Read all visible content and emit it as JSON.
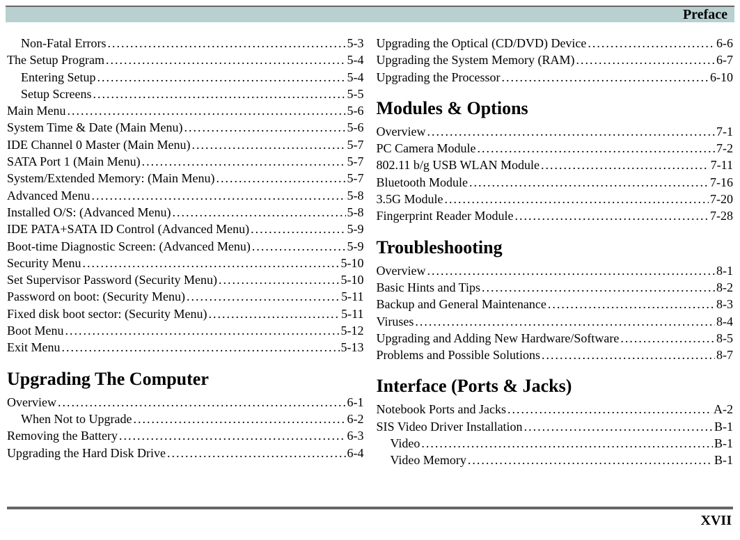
{
  "header": {
    "title": "Preface"
  },
  "footer": {
    "page_number": "XVII"
  },
  "left_column": [
    {
      "type": "entry",
      "indent": 1,
      "label": "Non-Fatal Errors",
      "page": "5-3"
    },
    {
      "type": "entry",
      "indent": 0,
      "label": "The Setup Program",
      "page": "5-4"
    },
    {
      "type": "entry",
      "indent": 1,
      "label": "Entering Setup",
      "page": "5-4"
    },
    {
      "type": "entry",
      "indent": 1,
      "label": "Setup Screens",
      "page": "5-5"
    },
    {
      "type": "entry",
      "indent": 0,
      "label": "Main Menu",
      "page": "5-6"
    },
    {
      "type": "entry",
      "indent": 0,
      "label": "System Time & Date (Main Menu)",
      "page": "5-6"
    },
    {
      "type": "entry",
      "indent": 0,
      "label": "IDE Channel 0 Master (Main Menu)",
      "page": "5-7"
    },
    {
      "type": "entry",
      "indent": 0,
      "label": "SATA Port 1 (Main Menu)",
      "page": "5-7"
    },
    {
      "type": "entry",
      "indent": 0,
      "label": "System/Extended Memory: (Main Menu)",
      "page": "5-7"
    },
    {
      "type": "entry",
      "indent": 0,
      "label": "Advanced Menu",
      "page": "5-8"
    },
    {
      "type": "entry",
      "indent": 0,
      "label": "Installed O/S: (Advanced Menu)",
      "page": "5-8"
    },
    {
      "type": "entry",
      "indent": 0,
      "label": "IDE PATA+SATA ID Control (Advanced Menu)",
      "page": "5-9"
    },
    {
      "type": "entry",
      "indent": 0,
      "label": "Boot-time Diagnostic Screen: (Advanced Menu)",
      "page": "5-9"
    },
    {
      "type": "entry",
      "indent": 0,
      "label": "Security Menu",
      "page": "5-10"
    },
    {
      "type": "entry",
      "indent": 0,
      "label": "Set Supervisor Password (Security Menu)",
      "page": "5-10"
    },
    {
      "type": "entry",
      "indent": 0,
      "label": "Password on boot: (Security Menu)",
      "page": "5-11"
    },
    {
      "type": "entry",
      "indent": 0,
      "label": "Fixed disk boot sector: (Security Menu)",
      "page": "5-11"
    },
    {
      "type": "entry",
      "indent": 0,
      "label": "Boot Menu",
      "page": "5-12"
    },
    {
      "type": "entry",
      "indent": 0,
      "label": "Exit Menu",
      "page": "5-13"
    },
    {
      "type": "heading",
      "label": "Upgrading The Computer"
    },
    {
      "type": "entry",
      "indent": 0,
      "label": "Overview",
      "page": "6-1"
    },
    {
      "type": "entry",
      "indent": 1,
      "label": "When Not to Upgrade",
      "page": "6-2"
    },
    {
      "type": "entry",
      "indent": 0,
      "label": "Removing the Battery",
      "page": "6-3"
    },
    {
      "type": "entry",
      "indent": 0,
      "label": "Upgrading the Hard Disk Drive",
      "page": "6-4"
    }
  ],
  "right_column": [
    {
      "type": "entry",
      "indent": 0,
      "label": "Upgrading the Optical (CD/DVD) Device",
      "page": "6-6"
    },
    {
      "type": "entry",
      "indent": 0,
      "label": "Upgrading the System Memory (RAM)",
      "page": "6-7"
    },
    {
      "type": "entry",
      "indent": 0,
      "label": "Upgrading the Processor",
      "page": "6-10"
    },
    {
      "type": "heading",
      "label": "Modules & Options"
    },
    {
      "type": "entry",
      "indent": 0,
      "label": "Overview",
      "page": "7-1"
    },
    {
      "type": "entry",
      "indent": 0,
      "label": "PC Camera Module",
      "page": "7-2"
    },
    {
      "type": "entry",
      "indent": 0,
      "label": "802.11 b/g USB WLAN Module",
      "page": "7-11"
    },
    {
      "type": "entry",
      "indent": 0,
      "label": "Bluetooth Module",
      "page": "7-16"
    },
    {
      "type": "entry",
      "indent": 0,
      "label": "3.5G Module",
      "page": "7-20"
    },
    {
      "type": "entry",
      "indent": 0,
      "label": "Fingerprint Reader Module",
      "page": "7-28"
    },
    {
      "type": "heading",
      "label": "Troubleshooting"
    },
    {
      "type": "entry",
      "indent": 0,
      "label": "Overview",
      "page": "8-1"
    },
    {
      "type": "entry",
      "indent": 0,
      "label": "Basic Hints and Tips",
      "page": "8-2"
    },
    {
      "type": "entry",
      "indent": 0,
      "label": "Backup and General Maintenance",
      "page": "8-3"
    },
    {
      "type": "entry",
      "indent": 0,
      "label": "Viruses",
      "page": "8-4"
    },
    {
      "type": "entry",
      "indent": 0,
      "label": "Upgrading and Adding New Hardware/Software",
      "page": "8-5"
    },
    {
      "type": "entry",
      "indent": 0,
      "label": "Problems and Possible Solutions",
      "page": "8-7"
    },
    {
      "type": "heading",
      "label": "Interface (Ports & Jacks)"
    },
    {
      "type": "entry",
      "indent": 0,
      "label": "Notebook Ports and Jacks",
      "page": "A-2"
    },
    {
      "type": "entry",
      "indent": 0,
      "label": "SIS Video Driver Installation",
      "page": "B-1"
    },
    {
      "type": "entry",
      "indent": 1,
      "label": "Video",
      "page": "B-1"
    },
    {
      "type": "entry",
      "indent": 1,
      "label": "Video Memory",
      "page": "B-1"
    }
  ]
}
